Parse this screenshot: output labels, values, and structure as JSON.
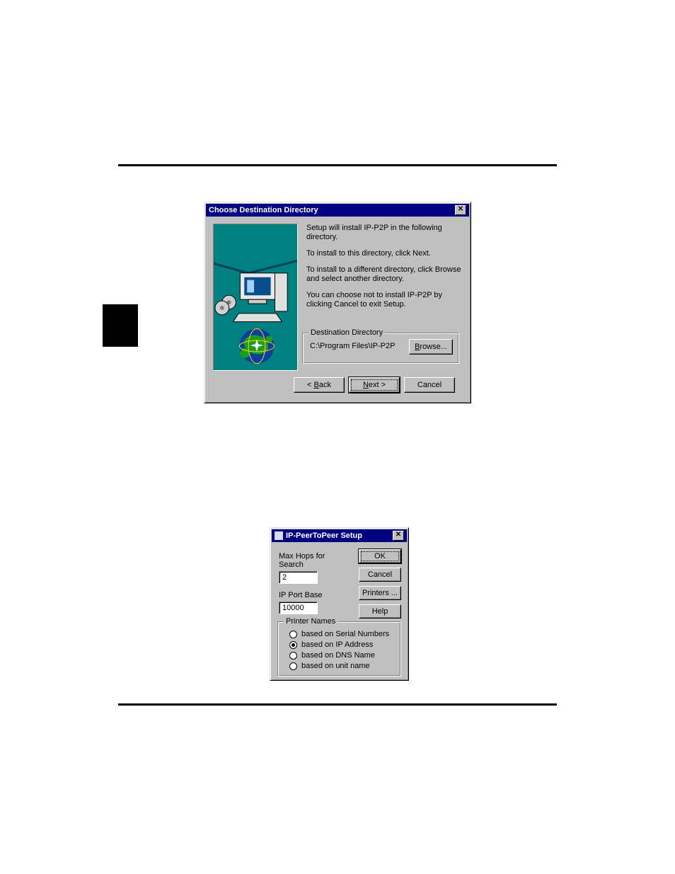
{
  "dialog1": {
    "title": "Choose Destination Directory",
    "close_symbol": "✕",
    "text_lines": {
      "line1": "Setup will install IP-P2P in the following directory.",
      "line2": "To install to this directory, click Next.",
      "line3": "To install to a different directory, click Browse and select another directory.",
      "line4": "You can choose not to install IP-P2P by clicking Cancel to exit Setup."
    },
    "dest_group_title": "Destination Directory",
    "dest_path": "C:\\Program Files\\IP-P2P",
    "browse_label_prefix": "B",
    "browse_label_rest": "rowse...",
    "back_prefix": "< ",
    "back_u": "B",
    "back_rest": "ack",
    "next_u": "N",
    "next_rest": "ext >",
    "cancel_label": "Cancel"
  },
  "dialog2": {
    "title": "IP-PeerToPeer Setup",
    "close_symbol": "✕",
    "max_hops_label": "Max Hops for Search",
    "max_hops_value": "2",
    "ip_port_label": "IP Port Base",
    "ip_port_value": "10000",
    "ok_label": "OK",
    "cancel_label": "Cancel",
    "printers_label": "Printers ...",
    "help_label": "Help",
    "printer_names_title": "Printer Names",
    "radios": {
      "serial": "based on Serial Numbers",
      "ip": "based on IP Address",
      "dns": "based on DNS Name",
      "unit": "based on unit name"
    },
    "selected_radio": "ip"
  }
}
